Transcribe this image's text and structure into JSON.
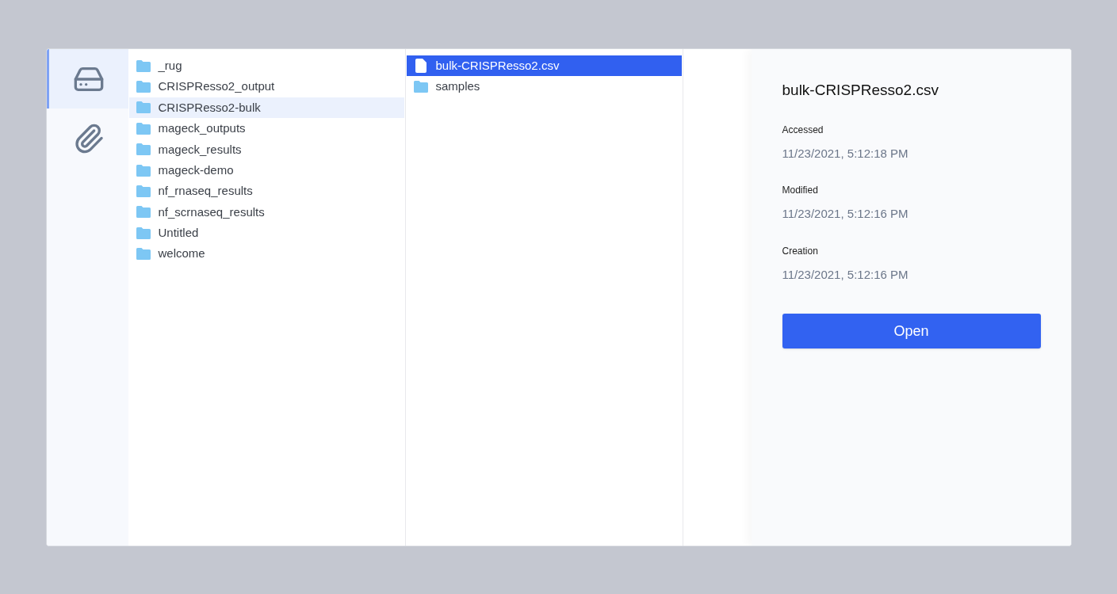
{
  "sidebar": {
    "items": [
      {
        "kind": "drive",
        "selected": true
      },
      {
        "kind": "attachment",
        "selected": false
      }
    ]
  },
  "columns": [
    {
      "active": false,
      "items": [
        {
          "kind": "folder",
          "name": "_rug",
          "selected": false
        },
        {
          "kind": "folder",
          "name": "CRISPResso2_output",
          "selected": false
        },
        {
          "kind": "folder",
          "name": "CRISPResso2-bulk",
          "selected": true
        },
        {
          "kind": "folder",
          "name": "mageck_outputs",
          "selected": false
        },
        {
          "kind": "folder",
          "name": "mageck_results",
          "selected": false
        },
        {
          "kind": "folder",
          "name": "mageck-demo",
          "selected": false
        },
        {
          "kind": "folder",
          "name": "nf_rnaseq_results",
          "selected": false
        },
        {
          "kind": "folder",
          "name": "nf_scrnaseq_results",
          "selected": false
        },
        {
          "kind": "folder",
          "name": "Untitled",
          "selected": false
        },
        {
          "kind": "folder",
          "name": "welcome",
          "selected": false
        }
      ]
    },
    {
      "active": true,
      "items": [
        {
          "kind": "file",
          "name": "bulk-CRISPResso2.csv",
          "selected": true
        },
        {
          "kind": "folder",
          "name": "samples",
          "selected": false
        }
      ]
    }
  ],
  "details": {
    "title": "bulk-CRISPResso2.csv",
    "fields": [
      {
        "label": "Accessed",
        "value": "11/23/2021, 5:12:18 PM"
      },
      {
        "label": "Modified",
        "value": "11/23/2021, 5:12:16 PM"
      },
      {
        "label": "Creation",
        "value": "11/23/2021, 5:12:16 PM"
      }
    ],
    "button": "Open"
  }
}
